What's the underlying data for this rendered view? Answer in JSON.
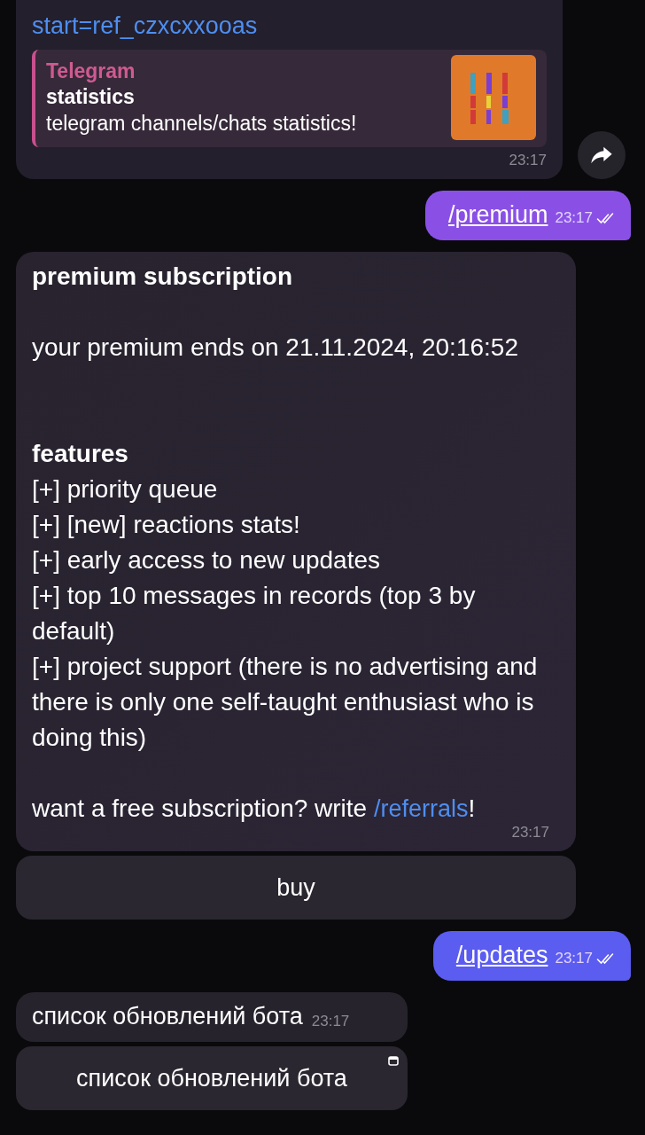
{
  "messages": [
    {
      "kind": "preview",
      "link": "start=ref_czxcxxooas",
      "preview": {
        "site": "Telegram",
        "title": "statistics",
        "description": "telegram channels/chats statistics!"
      },
      "time": "23:17",
      "forward": true
    },
    {
      "kind": "outgoing",
      "color": "#8a50e6",
      "text": "/premium",
      "time": "23:17",
      "read": true
    },
    {
      "kind": "text",
      "time": "23:17",
      "paragraphs": [
        {
          "kind": "title",
          "text": "premium subscription"
        },
        {
          "kind": "notice",
          "text": " your premium ends on 21.11.2024, 20:16:52"
        },
        {
          "kind": "heading",
          "text": "features"
        },
        {
          "kind": "item",
          "text": "[+] priority queue"
        },
        {
          "kind": "item",
          "text": "[+] [new] reactions stats!"
        },
        {
          "kind": "item",
          "text": "[+] early access to new updates"
        },
        {
          "kind": "item",
          "text": "[+] top 10 messages in records (top 3 by default)"
        },
        {
          "kind": "item",
          "text": "[+] project support (there is no advertising and there is only one self-taught enthusiast who is doing this)"
        },
        {
          "kind": "cta",
          "text": "want a free subscription? write ",
          "link": "/referrals",
          "after": "!"
        }
      ]
    },
    {
      "kind": "button",
      "label": "buy",
      "wide": true
    },
    {
      "kind": "outgoing",
      "color": "#5b5cf0",
      "text": "/updates",
      "time": "23:17",
      "read": true
    },
    {
      "kind": "short",
      "text": "список обновлений бота",
      "time": "23:17"
    },
    {
      "kind": "button",
      "label": "список обновлений бота",
      "wide": false,
      "webapp": true
    }
  ]
}
